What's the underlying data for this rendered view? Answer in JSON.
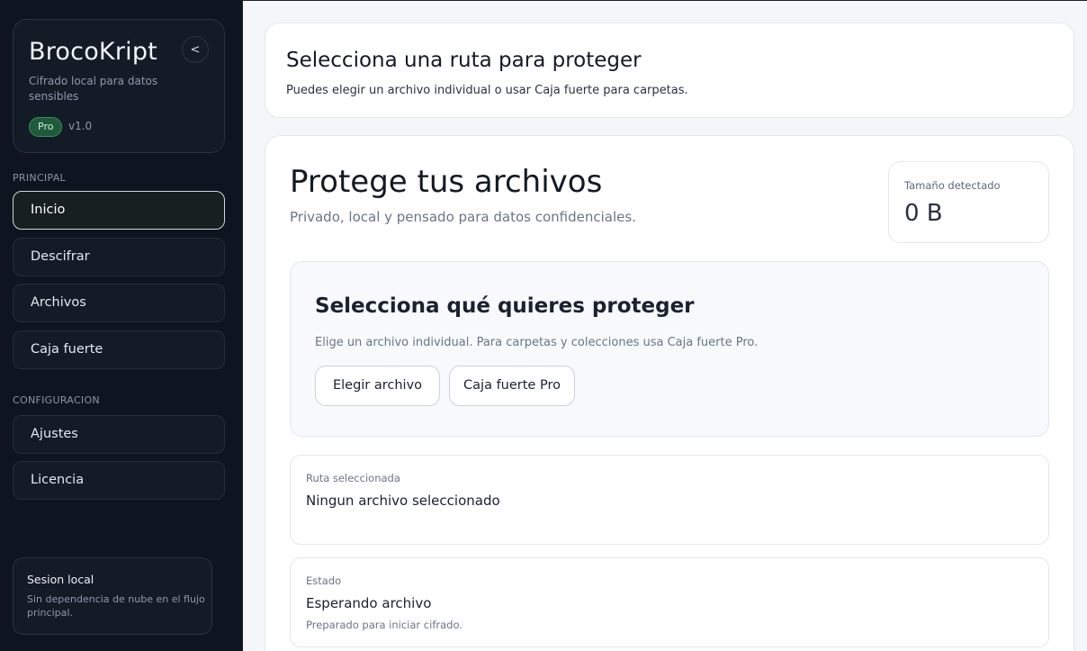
{
  "sidebar": {
    "brand": {
      "title": "BrocoKript",
      "subtitle": "Cifrado local para datos sensibles",
      "badge": "Pro",
      "version": "v1.0",
      "collapse_label": "<"
    },
    "sections": [
      {
        "label": "PRINCIPAL",
        "items": [
          {
            "label": "Inicio",
            "active": true
          },
          {
            "label": "Descifrar",
            "active": false
          },
          {
            "label": "Archivos",
            "active": false
          },
          {
            "label": "Caja fuerte",
            "active": false
          }
        ]
      },
      {
        "label": "CONFIGURACION",
        "items": [
          {
            "label": "Ajustes",
            "active": false
          },
          {
            "label": "Licencia",
            "active": false
          }
        ]
      }
    ],
    "session": {
      "title": "Sesion local",
      "text": "Sin dependencia de nube en el flujo principal."
    }
  },
  "header": {
    "title": "Selecciona una ruta para proteger",
    "subtitle": "Puedes elegir un archivo individual o usar Caja fuerte para carpetas."
  },
  "main": {
    "title": "Protege tus archivos",
    "subtitle": "Privado, local y pensado para datos confidenciales.",
    "size_card": {
      "label": "Tamaño detectado",
      "value": "0 B"
    },
    "select_panel": {
      "title": "Selecciona qué quieres proteger",
      "subtitle": "Elige un archivo individual. Para carpetas y colecciones usa Caja fuerte Pro.",
      "choose_file_label": "Elegir archivo",
      "vault_label": "Caja fuerte Pro"
    },
    "route": {
      "label": "Ruta seleccionada",
      "value": "Ningun archivo seleccionado"
    },
    "state": {
      "label": "Estado",
      "value": "Esperando archivo",
      "note": "Preparado para iniciar cifrado."
    }
  },
  "colors": {
    "sidebar_bg": "#0f1520",
    "accent_badge": "#1f5a3b",
    "page_bg": "#f4f6f9"
  }
}
